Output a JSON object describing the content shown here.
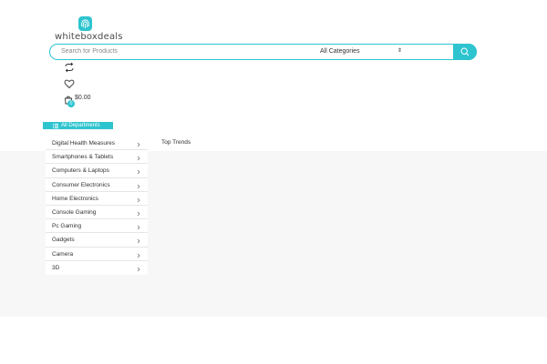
{
  "header": {
    "logo_text": "whiteboxdeals",
    "search": {
      "placeholder": "Search for Products",
      "value": "",
      "category_selected": "All Categories"
    },
    "cart": {
      "count": "0",
      "total": "$0.00"
    }
  },
  "departments": {
    "button_label": "All Departments",
    "items": [
      {
        "label": "Digital Health Measures"
      },
      {
        "label": "Smartphones & Tablets"
      },
      {
        "label": "Computers & Laptops"
      },
      {
        "label": "Consumer Electronics"
      },
      {
        "label": "Home Electronics"
      },
      {
        "label": "Console Gaming"
      },
      {
        "label": "Pc Gaming"
      },
      {
        "label": "Gadgets"
      },
      {
        "label": "Camera"
      },
      {
        "label": "3D"
      }
    ]
  },
  "main": {
    "section_title": "Top Trends"
  },
  "colors": {
    "accent": "#2ec4cf",
    "band": "#f7f7f7"
  },
  "icons": [
    "fingerprint-logo-icon",
    "search-icon",
    "compare-icon",
    "heart-icon",
    "cart-icon",
    "menu-icon",
    "chevron-right-icon"
  ]
}
